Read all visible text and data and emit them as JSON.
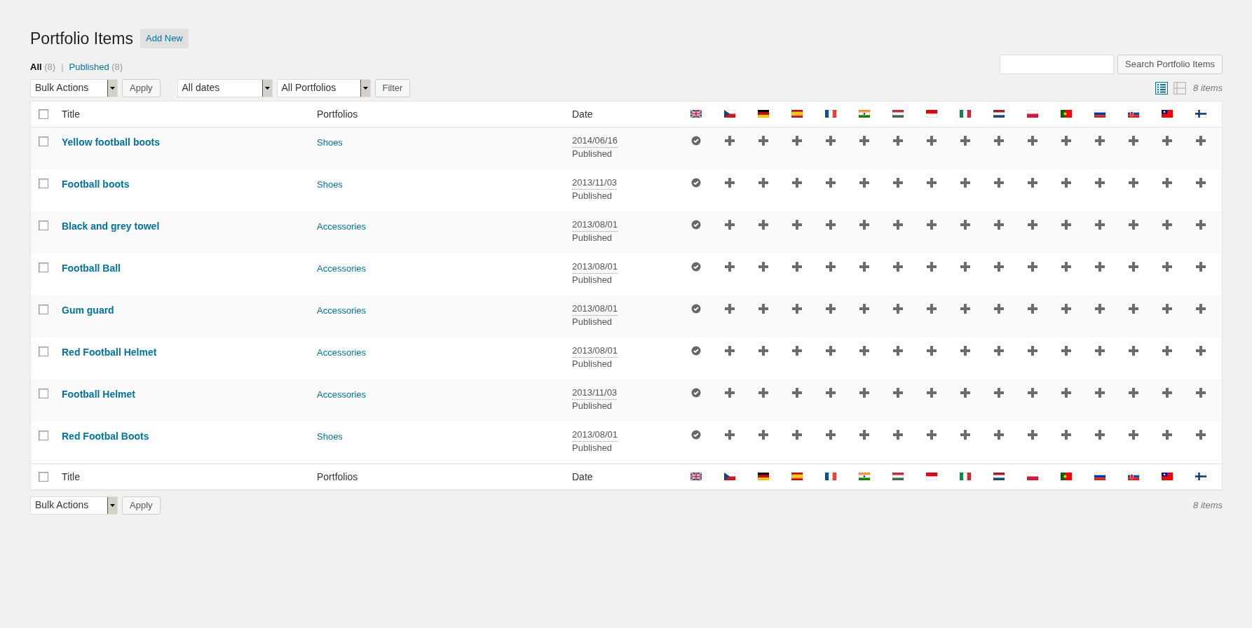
{
  "page": {
    "title": "Portfolio Items",
    "add_new": "Add New"
  },
  "filters": [
    {
      "label": "All",
      "count": "(8)",
      "selected": true
    },
    {
      "label": "Published",
      "count": "(8)",
      "selected": false
    }
  ],
  "filter_separator": "|",
  "search": {
    "button": "Search Portfolio Items"
  },
  "top_actions": {
    "bulk": "Bulk Actions",
    "apply": "Apply",
    "dates": "All dates",
    "portfolios": "All Portfolios",
    "filter": "Filter"
  },
  "view_modes": [
    {
      "kind": "list",
      "selected": true
    },
    {
      "kind": "excerpt",
      "selected": false
    }
  ],
  "items_count_top": "8 items",
  "columns": {
    "select_all_checked": false,
    "title": "Title",
    "portfolios": "Portfolios",
    "date": "Date"
  },
  "languages": [
    {
      "kind": "gb"
    },
    {
      "kind": "cz"
    },
    {
      "kind": "de"
    },
    {
      "kind": "es"
    },
    {
      "kind": "fr"
    },
    {
      "kind": "in"
    },
    {
      "kind": "hu"
    },
    {
      "kind": "id"
    },
    {
      "kind": "it"
    },
    {
      "kind": "nl"
    },
    {
      "kind": "pl"
    },
    {
      "kind": "pt"
    },
    {
      "kind": "ru"
    },
    {
      "kind": "sk"
    },
    {
      "kind": "tw"
    },
    {
      "kind": "fi"
    }
  ],
  "rows": [
    {
      "checked": false,
      "title": "Yellow football boots",
      "portfolio": "Shoes",
      "date": "2014/06/16",
      "status": "Published",
      "translations": [
        true,
        false,
        false,
        false,
        false,
        false,
        false,
        false,
        false,
        false,
        false,
        false,
        false,
        false,
        false,
        false
      ]
    },
    {
      "checked": false,
      "title": "Football boots",
      "portfolio": "Shoes",
      "date": "2013/11/03",
      "status": "Published",
      "translations": [
        true,
        false,
        false,
        false,
        false,
        false,
        false,
        false,
        false,
        false,
        false,
        false,
        false,
        false,
        false,
        false
      ]
    },
    {
      "checked": false,
      "title": "Black and grey towel",
      "portfolio": "Accessories",
      "date": "2013/08/01",
      "status": "Published",
      "translations": [
        true,
        false,
        false,
        false,
        false,
        false,
        false,
        false,
        false,
        false,
        false,
        false,
        false,
        false,
        false,
        false
      ]
    },
    {
      "checked": false,
      "title": "Football Ball",
      "portfolio": "Accessories",
      "date": "2013/08/01",
      "status": "Published",
      "translations": [
        true,
        false,
        false,
        false,
        false,
        false,
        false,
        false,
        false,
        false,
        false,
        false,
        false,
        false,
        false,
        false
      ]
    },
    {
      "checked": false,
      "title": "Gum guard",
      "portfolio": "Accessories",
      "date": "2013/08/01",
      "status": "Published",
      "translations": [
        true,
        false,
        false,
        false,
        false,
        false,
        false,
        false,
        false,
        false,
        false,
        false,
        false,
        false,
        false,
        false
      ]
    },
    {
      "checked": false,
      "title": "Red Football Helmet",
      "portfolio": "Accessories",
      "date": "2013/08/01",
      "status": "Published",
      "translations": [
        true,
        false,
        false,
        false,
        false,
        false,
        false,
        false,
        false,
        false,
        false,
        false,
        false,
        false,
        false,
        false
      ]
    },
    {
      "checked": false,
      "title": "Football Helmet",
      "portfolio": "Accessories",
      "date": "2013/11/03",
      "status": "Published",
      "translations": [
        true,
        false,
        false,
        false,
        false,
        false,
        false,
        false,
        false,
        false,
        false,
        false,
        false,
        false,
        false,
        false
      ]
    },
    {
      "checked": false,
      "title": "Red Footbal Boots",
      "portfolio": "Shoes",
      "date": "2013/08/01",
      "status": "Published",
      "translations": [
        true,
        false,
        false,
        false,
        false,
        false,
        false,
        false,
        false,
        false,
        false,
        false,
        false,
        false,
        false,
        false
      ]
    }
  ],
  "footer_columns": {
    "select_all_checked": false,
    "title": "Title",
    "portfolios": "Portfolios",
    "date": "Date"
  },
  "bottom_actions": {
    "bulk": "Bulk Actions",
    "apply": "Apply"
  },
  "items_count_bottom": "8 items"
}
